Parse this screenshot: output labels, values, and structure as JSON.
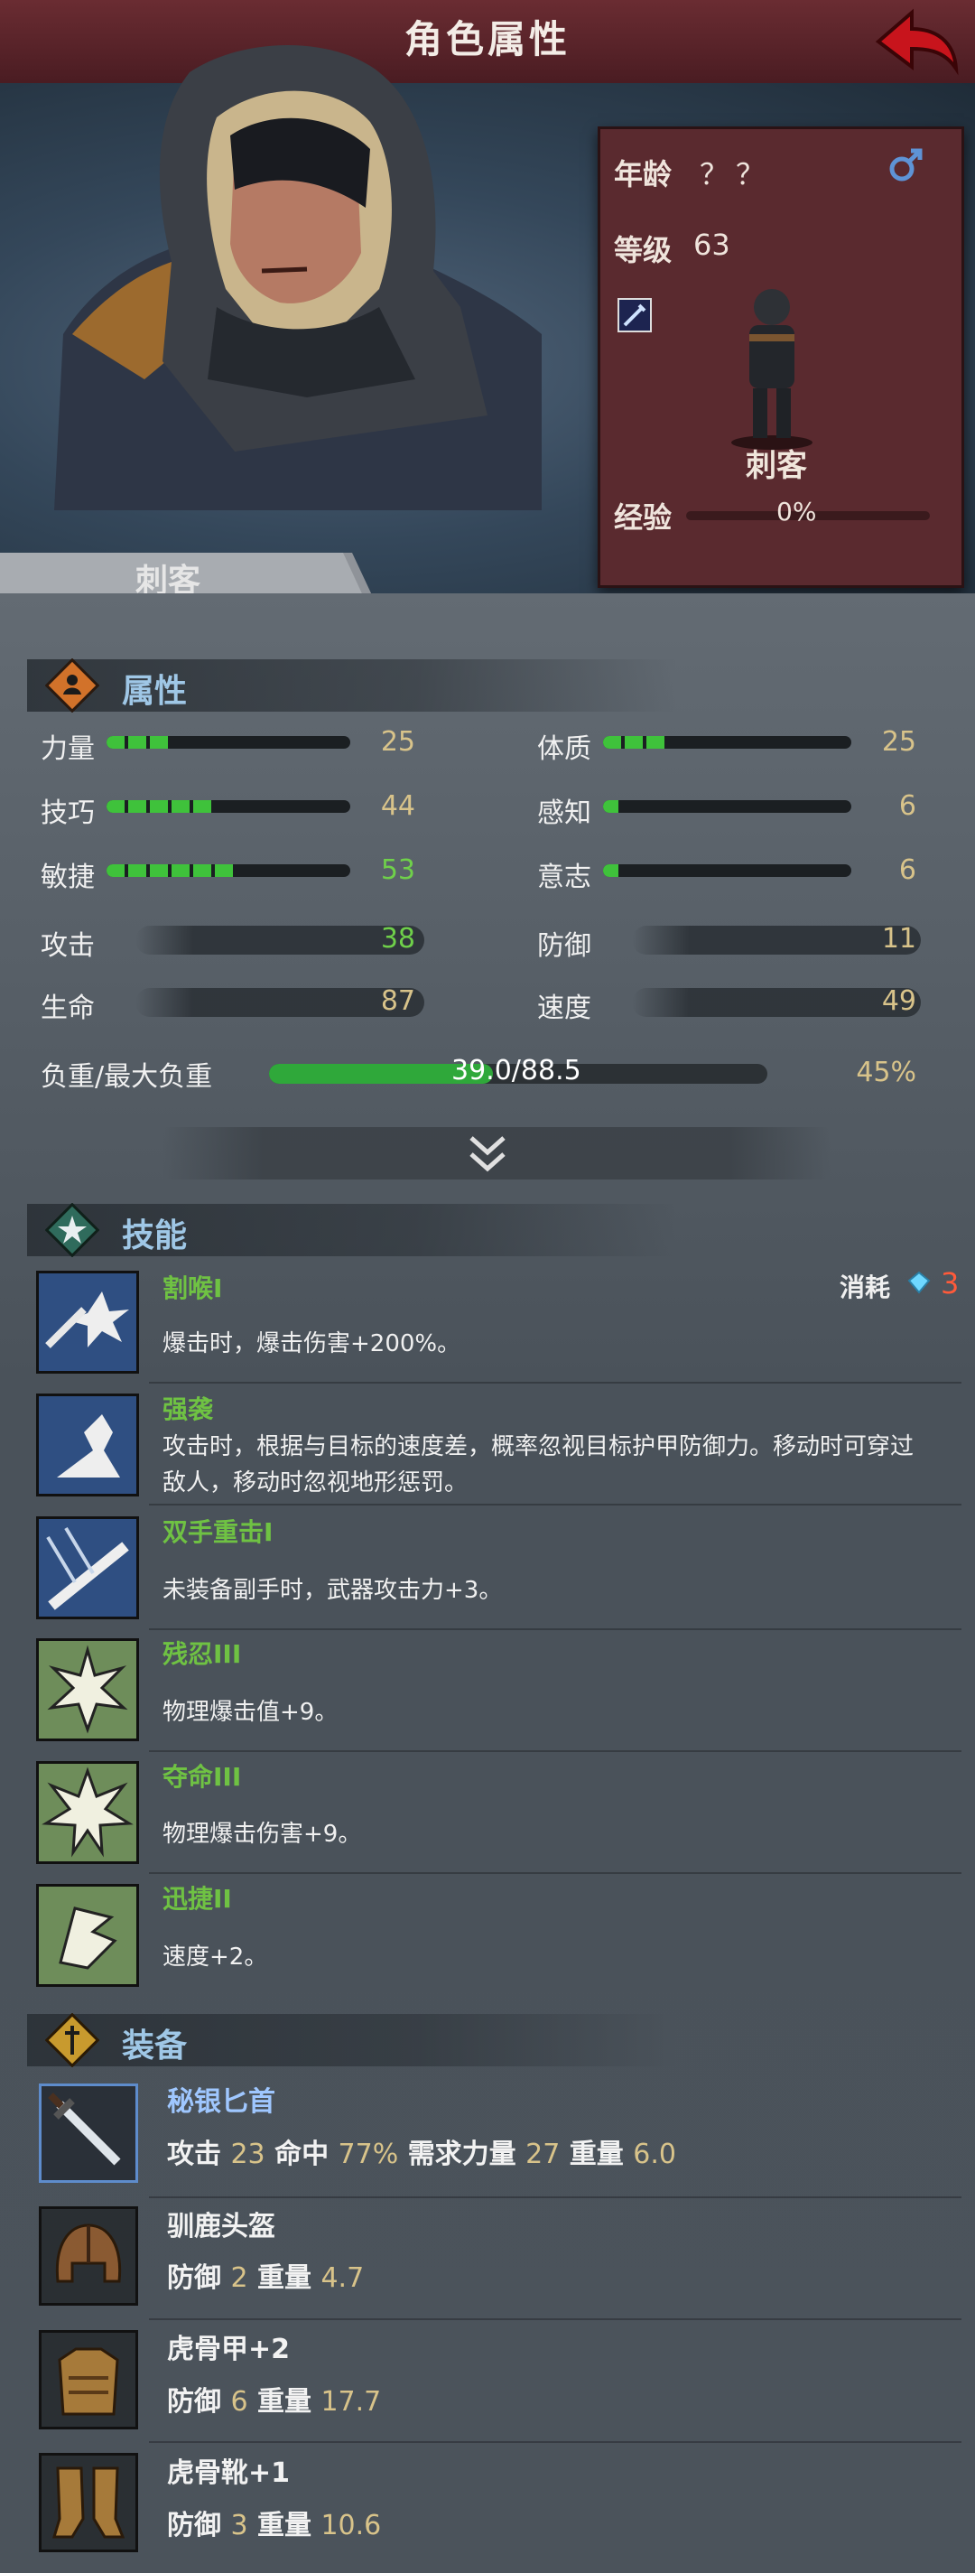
{
  "header": {
    "title": "角色属性"
  },
  "character": {
    "class_name": "刺客",
    "age_label": "年龄",
    "age_value": "？？",
    "level_label": "等级",
    "level_value": "63",
    "exp_label": "经验",
    "exp_value": "0%",
    "exp_progress": 0
  },
  "attributes": {
    "title": "属性",
    "primary": [
      {
        "label": "力量",
        "value": "25",
        "fill": 0.25
      },
      {
        "label": "体质",
        "value": "25",
        "fill": 0.25
      },
      {
        "label": "技巧",
        "value": "44",
        "fill": 0.44
      },
      {
        "label": "感知",
        "value": "6",
        "fill": 0.06
      },
      {
        "label": "敏捷",
        "value": "53",
        "fill": 0.53
      },
      {
        "label": "意志",
        "value": "6",
        "fill": 0.06
      }
    ],
    "secondary": [
      {
        "label": "攻击",
        "value": "38"
      },
      {
        "label": "防御",
        "value": "11"
      },
      {
        "label": "生命",
        "value": "87"
      },
      {
        "label": "速度",
        "value": "49"
      }
    ],
    "weight": {
      "label": "负重/最大负重",
      "current": "39.0",
      "max": "88.5",
      "text": "39.0/88.5",
      "percent": "45%",
      "fraction": 0.45
    }
  },
  "skills": {
    "title": "技能",
    "cost_label": "消耗",
    "cost_value": "3",
    "items": [
      {
        "name": "割喉I",
        "desc": "爆击时，爆击伤害+200%。"
      },
      {
        "name": "强袭",
        "desc": "攻击时，根据与目标的速度差，概率忽视目标护甲防御力。移动时可穿过敌人，移动时忽视地形惩罚。"
      },
      {
        "name": "双手重击I",
        "desc": "未装备副手时，武器攻击力+3。"
      },
      {
        "name": "残忍III",
        "desc": "物理爆击值+9。"
      },
      {
        "name": "夺命III",
        "desc": "物理爆击伤害+9。"
      },
      {
        "name": "迅捷II",
        "desc": "速度+2。"
      }
    ]
  },
  "equipment": {
    "title": "装备",
    "items": [
      {
        "name": "秘银匕首",
        "stats": [
          {
            "label": "攻击",
            "value": "23"
          },
          {
            "label": "命中",
            "value": "77%"
          },
          {
            "label": "需求力量",
            "value": "27"
          },
          {
            "label": "重量",
            "value": "6.0"
          }
        ]
      },
      {
        "name": "驯鹿头盔",
        "stats": [
          {
            "label": "防御",
            "value": "2"
          },
          {
            "label": "重量",
            "value": "4.7"
          }
        ]
      },
      {
        "name": "虎骨甲+2",
        "stats": [
          {
            "label": "防御",
            "value": "6"
          },
          {
            "label": "重量",
            "value": "17.7"
          }
        ]
      },
      {
        "name": "虎骨靴+1",
        "stats": [
          {
            "label": "防御",
            "value": "3"
          },
          {
            "label": "重量",
            "value": "10.6"
          }
        ]
      }
    ]
  },
  "colors": {
    "header": "#5a2228",
    "accent_green": "#6fc243",
    "value_gold": "#d8c38a",
    "section_blue": "#9fc7e6",
    "cost_red": "#ff5a3a"
  },
  "icons": [
    "back-arrow-icon",
    "male-gender-icon",
    "dagger-type-icon",
    "attributes-icon",
    "skills-icon",
    "equipment-icon",
    "chevron-down-icon"
  ]
}
